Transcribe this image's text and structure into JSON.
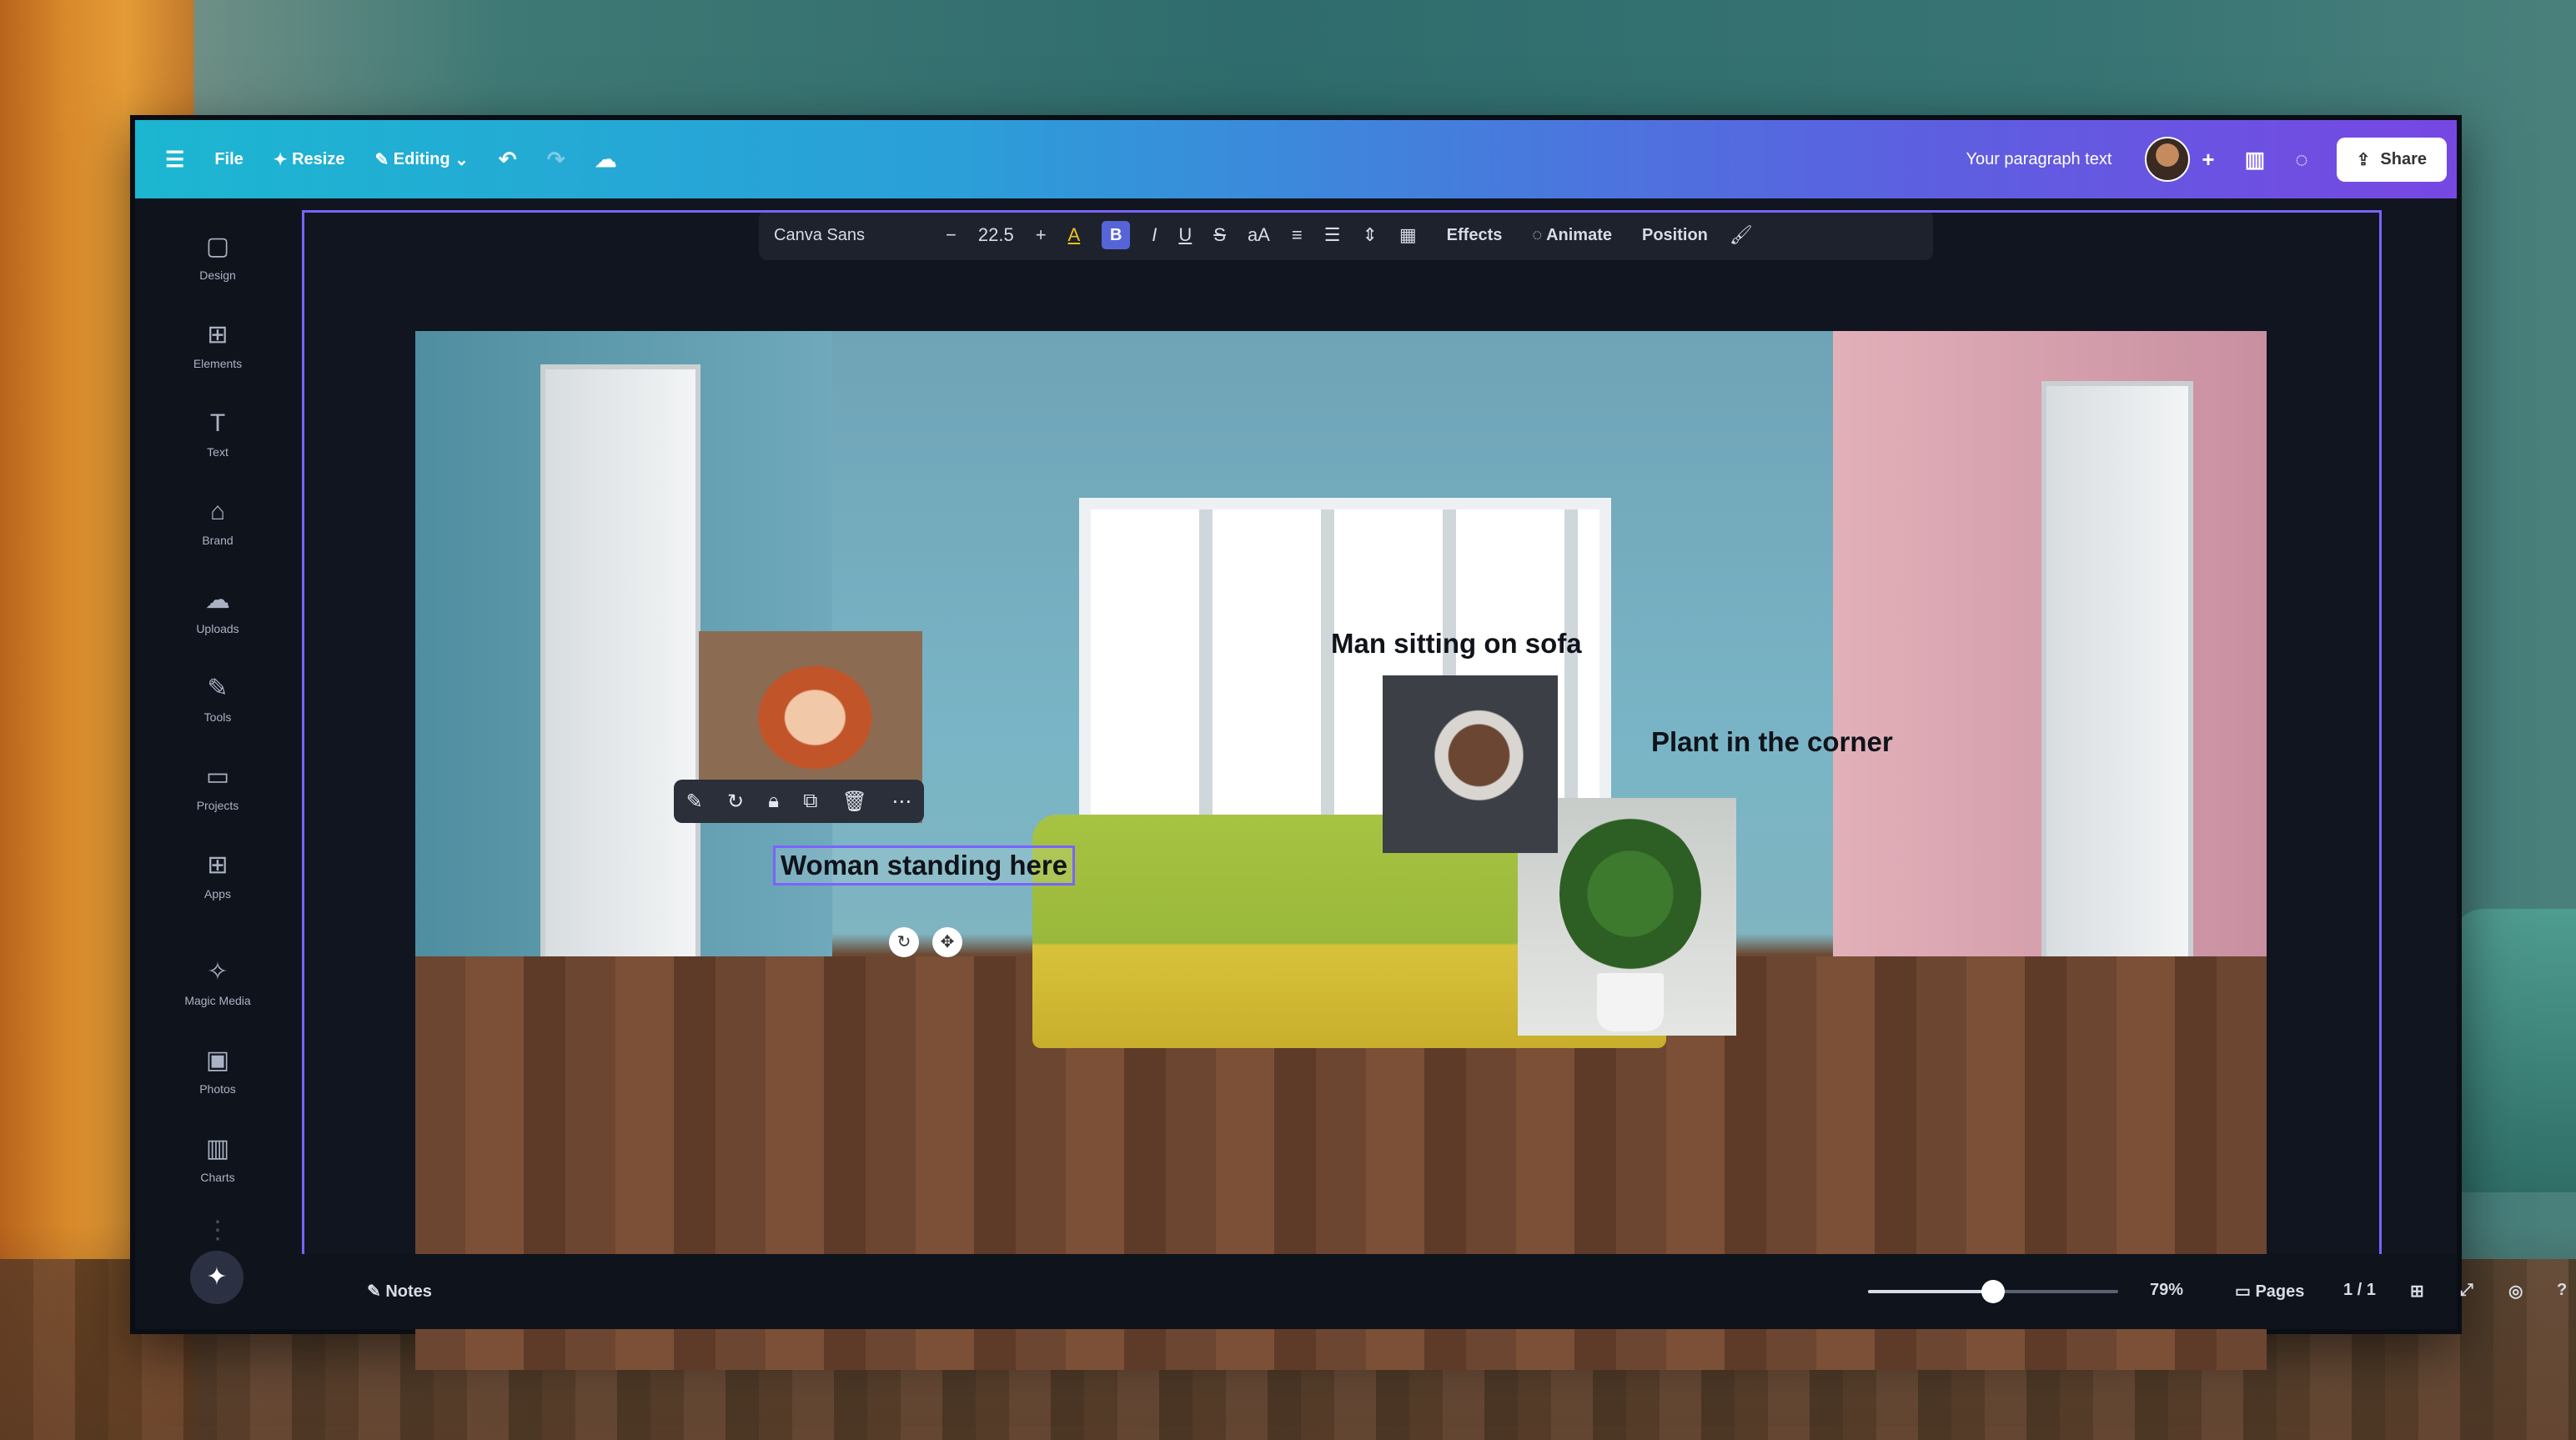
{
  "topbar": {
    "file_label": "File",
    "resize_label": "Resize",
    "editing_label": "Editing",
    "doc_title": "Your paragraph text",
    "share_label": "Share"
  },
  "sidebar": {
    "items": [
      {
        "label": "Design",
        "icon": "design-icon"
      },
      {
        "label": "Elements",
        "icon": "elements-icon"
      },
      {
        "label": "Text",
        "icon": "text-icon"
      },
      {
        "label": "Brand",
        "icon": "brand-icon"
      },
      {
        "label": "Uploads",
        "icon": "uploads-icon"
      },
      {
        "label": "Tools",
        "icon": "tools-icon"
      },
      {
        "label": "Projects",
        "icon": "projects-icon"
      },
      {
        "label": "Apps",
        "icon": "apps-icon"
      },
      {
        "label": "Magic Media",
        "icon": "magic-media-icon"
      },
      {
        "label": "Photos",
        "icon": "photos-icon"
      },
      {
        "label": "Charts",
        "icon": "charts-icon"
      }
    ]
  },
  "text_toolbar": {
    "font_name": "Canva Sans",
    "font_size": "22.5",
    "effects_label": "Effects",
    "animate_label": "Animate",
    "position_label": "Position"
  },
  "canvas": {
    "caption_woman": "Woman standing here",
    "caption_man": "Man sitting on sofa",
    "caption_plant": "Plant in the corner"
  },
  "bottombar": {
    "notes_label": "Notes",
    "zoom_percent": "79%",
    "zoom_fraction": 0.5,
    "pages_label": "Pages",
    "page_count": "1 / 1"
  },
  "colors": {
    "topbar_start": "#1cb6d1",
    "topbar_end": "#7747e3",
    "selection": "#7a63ff"
  }
}
